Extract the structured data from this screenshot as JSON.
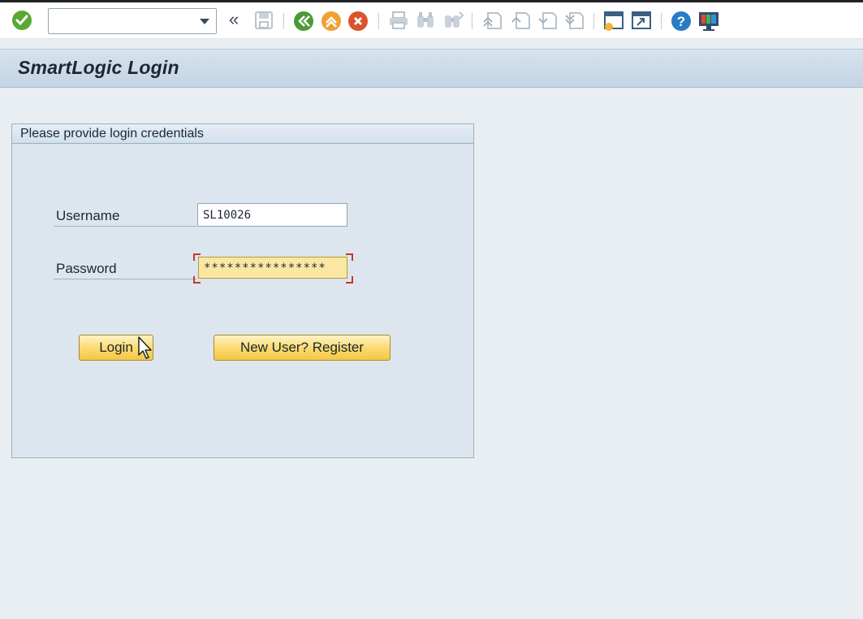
{
  "toolbar": {
    "command_field": {
      "value": "",
      "placeholder": ""
    },
    "icons": [
      "enter-check-icon",
      "back-icon",
      "save-icon",
      "back-green-icon",
      "exit-icon",
      "cancel-icon",
      "print-icon",
      "find-icon",
      "find-next-icon",
      "first-page-icon",
      "previous-page-icon",
      "next-page-icon",
      "last-page-icon",
      "new-session-icon",
      "shortcut-icon",
      "help-icon",
      "customize-layout-icon"
    ]
  },
  "header": {
    "title": "SmartLogic Login"
  },
  "panel": {
    "title": "Please provide login credentials",
    "username": {
      "label": "Username",
      "value": "SL10026"
    },
    "password": {
      "label": "Password",
      "value": "****************"
    },
    "login_button": "Login",
    "register_button": "New User? Register"
  },
  "colors": {
    "accent_yellow": "#fbd96b",
    "title_band": "#c3d4e3",
    "background": "#e8eef2",
    "check_green": "#5aa832",
    "exit_orange": "#f0a032",
    "cancel_red": "#d9532c",
    "help_blue": "#2a7bc6"
  }
}
